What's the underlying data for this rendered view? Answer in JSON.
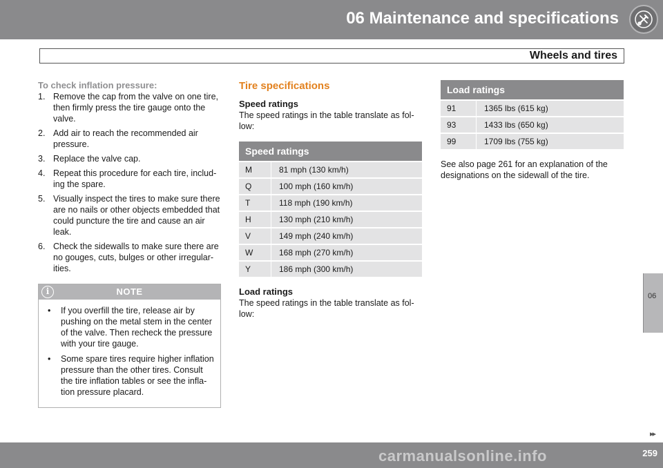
{
  "header": {
    "chapter_title": "06 Maintenance and specifications",
    "section_title": "Wheels and tires",
    "side_tab": "06"
  },
  "col1": {
    "heading": "To check inflation pressure:",
    "steps": [
      {
        "num": "1.",
        "text": "Remove the cap from the valve on one tire, then firmly press the tire gauge onto the valve."
      },
      {
        "num": "2.",
        "text": "Add air to reach the recommended air pressure."
      },
      {
        "num": "3.",
        "text": "Replace the valve cap."
      },
      {
        "num": "4.",
        "text": "Repeat this procedure for each tire, includ-ing the spare."
      },
      {
        "num": "5.",
        "text": "Visually inspect the tires to make sure there are no nails or other objects embedded that could puncture the tire and cause an air leak."
      },
      {
        "num": "6.",
        "text": "Check the sidewalls to make sure there are no gouges, cuts, bulges or other irregular-ities."
      }
    ],
    "note": {
      "title": "NOTE",
      "items": [
        "If you overfill the tire, release air by pushing on the metal stem in the center of the valve. Then recheck the pressure with your tire gauge.",
        "Some spare tires require higher inflation pressure than the other tires. Consult the tire inflation tables or see the infla-tion pressure placard."
      ]
    }
  },
  "col2": {
    "heading": "Tire specifications",
    "speed_subhead": "Speed ratings",
    "speed_text": "The speed ratings in the table translate as fol-low:",
    "speed_table": {
      "header": "Speed ratings",
      "rows": [
        {
          "code": "M",
          "value": "81 mph (130 km/h)"
        },
        {
          "code": "Q",
          "value": "100 mph (160 km/h)"
        },
        {
          "code": "T",
          "value": "118 mph (190 km/h)"
        },
        {
          "code": "H",
          "value": "130 mph (210 km/h)"
        },
        {
          "code": "V",
          "value": "149 mph (240 km/h)"
        },
        {
          "code": "W",
          "value": "168 mph (270 km/h)"
        },
        {
          "code": "Y",
          "value": "186 mph (300 km/h)"
        }
      ]
    },
    "load_subhead": "Load ratings",
    "load_text": "The speed ratings in the table translate as fol-low:"
  },
  "col3": {
    "load_table": {
      "header": "Load ratings",
      "rows": [
        {
          "code": "91",
          "value": "1365 lbs (615 kg)"
        },
        {
          "code": "93",
          "value": "1433 lbs (650 kg)"
        },
        {
          "code": "99",
          "value": "1709 lbs (755 kg)"
        }
      ]
    },
    "see_also": "See also page 261 for an explanation of the designations on the sidewall of the tire."
  },
  "footer": {
    "page_number": "259",
    "continue_glyph": "▸▸",
    "watermark": "carmanualsonline.info"
  }
}
